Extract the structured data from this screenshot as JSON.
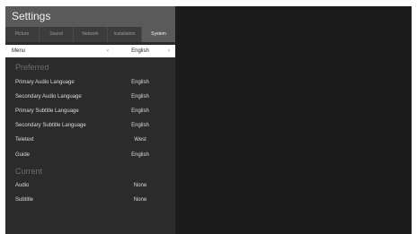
{
  "title": "Settings",
  "tabs": [
    {
      "label": "Picture"
    },
    {
      "label": "Sound"
    },
    {
      "label": "Network"
    },
    {
      "label": "Installation"
    },
    {
      "label": "System"
    }
  ],
  "active_tab": "System",
  "menu": {
    "label": "Menu",
    "value": "English"
  },
  "preferred": {
    "heading": "Preferred",
    "rows": [
      {
        "label": "Primary Audio Language",
        "value": "English"
      },
      {
        "label": "Secondary Audio Language",
        "value": "English"
      },
      {
        "label": "Primary Subtitle Language",
        "value": "English"
      },
      {
        "label": "Secondary Subtitle Language",
        "value": "English"
      },
      {
        "label": "Teletext",
        "value": "West"
      },
      {
        "label": "Guide",
        "value": "English"
      }
    ]
  },
  "current": {
    "heading": "Current",
    "rows": [
      {
        "label": "Audio",
        "value": "None"
      },
      {
        "label": "Subtitle",
        "value": "None"
      }
    ]
  },
  "icons": {
    "left_arrow": "chevron-left-icon",
    "right_arrow": "chevron-right-icon"
  }
}
